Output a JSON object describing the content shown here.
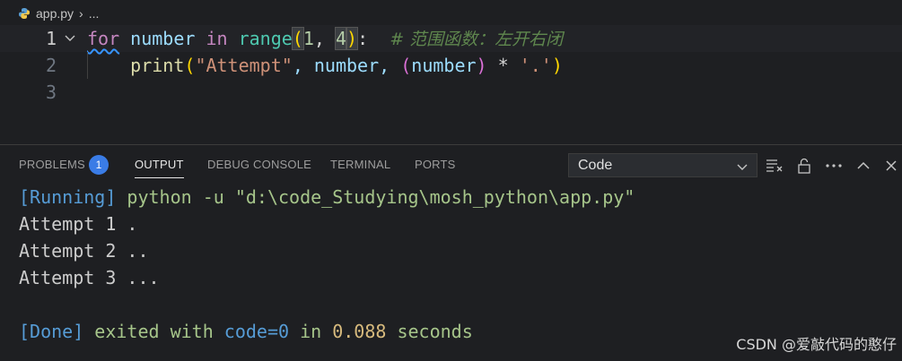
{
  "breadcrumb": {
    "file": "app.py",
    "ellipsis": "..."
  },
  "editor": {
    "lines": [
      {
        "number": "1",
        "tokens": [
          "for",
          " number ",
          "in",
          " range",
          "(",
          "1",
          ", ",
          "4",
          ")",
          ":  ",
          "# 范围函数：左开右闭"
        ]
      },
      {
        "number": "2",
        "tokens": [
          "    ",
          "print",
          "(",
          "\"Attempt\"",
          ", number, ",
          "(",
          "number",
          ")",
          " * ",
          "'.'",
          ")"
        ]
      },
      {
        "number": "3",
        "tokens": []
      }
    ]
  },
  "panel": {
    "tabs": [
      "PROBLEMS",
      "OUTPUT",
      "DEBUG CONSOLE",
      "TERMINAL",
      "PORTS"
    ],
    "problems_count": "1",
    "active_tab": "OUTPUT",
    "output_channel": "Code"
  },
  "output": {
    "running_tag": "[Running]",
    "running_cmd": " python -u \"d:\\code_Studying\\mosh_python\\app.py\"",
    "results": [
      "Attempt 1 .",
      "Attempt 2 ..",
      "Attempt 3 ..."
    ],
    "done_tag": "[Done]",
    "done_prefix": " exited with ",
    "done_code": "code=0",
    "done_in": " in ",
    "done_time": "0.088",
    "done_seconds": " seconds"
  },
  "watermark": "CSDN @爱敲代码的憨仔"
}
